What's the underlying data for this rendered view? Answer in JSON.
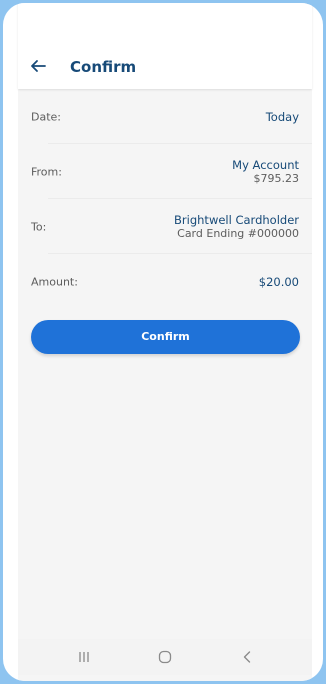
{
  "header": {
    "title": "Confirm",
    "back_icon": "arrow-left-icon"
  },
  "details": {
    "date": {
      "label": "Date:",
      "value": "Today"
    },
    "from": {
      "label": "From:",
      "account": "My Account",
      "balance": "$795.23"
    },
    "to": {
      "label": "To:",
      "name": "Brightwell Cardholder",
      "card": "Card Ending #000000"
    },
    "amount": {
      "label": "Amount:",
      "value": "$20.00"
    }
  },
  "actions": {
    "confirm_label": "Confirm"
  },
  "system_nav": {
    "icons": [
      "recent-apps-icon",
      "home-icon",
      "back-nav-icon"
    ]
  },
  "colors": {
    "accent": "#1f72d8",
    "title": "#174a78",
    "frame": "#8ec4f0"
  }
}
